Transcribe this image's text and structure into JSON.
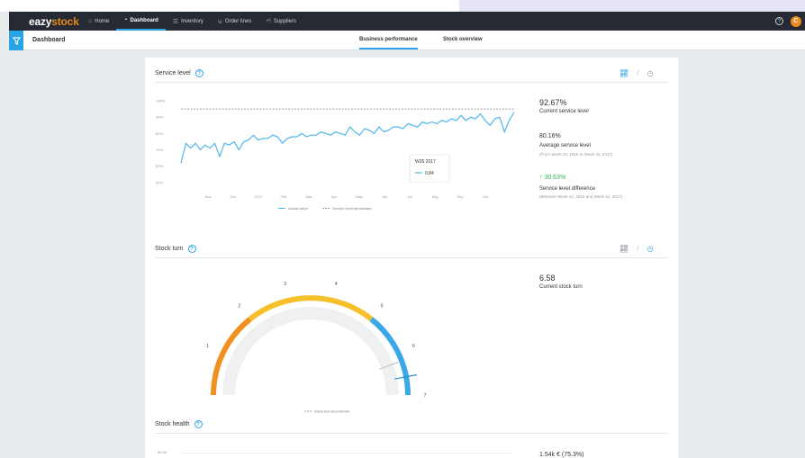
{
  "app": {
    "logo_prefix": "eazy",
    "logo_suffix": "stock",
    "help_glyph": "?",
    "avatar_initial": "C",
    "nav": [
      {
        "label": "Home",
        "icon": "home-icon",
        "glyph": "⌂",
        "active": false
      },
      {
        "label": "Dashboard",
        "icon": "dashboard-icon",
        "glyph": "◔",
        "active": true
      },
      {
        "label": "Inventory",
        "icon": "inventory-icon",
        "glyph": "☰",
        "active": false
      },
      {
        "label": "Order lines",
        "icon": "cart-icon",
        "glyph": "⊍",
        "active": false
      },
      {
        "label": "Suppliers",
        "icon": "suppliers-icon",
        "glyph": "⩤",
        "active": false
      }
    ]
  },
  "subheader": {
    "title": "Dashboard",
    "tabs": [
      {
        "label": "Business performance",
        "active": true
      },
      {
        "label": "Stock overview",
        "active": false
      }
    ]
  },
  "service_level": {
    "title": "Service level",
    "current_value": "92.67%",
    "current_label": "Current service level",
    "average_value": "80.16%",
    "average_label": "Average service level",
    "average_range": "(From Week 42, 2016 to Week 42, 2017)",
    "difference_value": "30.63%",
    "difference_label": "Service level difference",
    "difference_range": "(Between Week 42, 2016 and Week 42, 2017)",
    "tooltip_title": "W26 2017",
    "tooltip_value": "0.84",
    "legend_actual": "Actual value",
    "legend_benchmark": "Service level benchmark"
  },
  "stock_turn": {
    "title": "Stock turn",
    "current_value": "6.58",
    "current_label": "Current stock turn",
    "legend_benchmark": "Stock turn benchmark"
  },
  "stock_health": {
    "title": "Stock health",
    "first_value": "1.54k € (75.3%)",
    "first_tick": "$2.5k"
  },
  "colors": {
    "accent": "#2aa3e5",
    "gauge_orange": "#f0901e",
    "gauge_yellow": "#f7c02a",
    "gauge_blue": "#3aa7e8",
    "positive": "#2db35d"
  },
  "chart_data": [
    {
      "type": "line",
      "title": "Service level",
      "x": [
        "Nov",
        "Dec",
        "2017",
        "Feb",
        "Mar",
        "Apr",
        "May",
        "Jun",
        "Jul",
        "Aug",
        "Sep",
        "Oct"
      ],
      "y_ticks": [
        "100%",
        "90%",
        "80%",
        "70%",
        "60%",
        "50%"
      ],
      "ylim": [
        0.45,
        1.0
      ],
      "series": [
        {
          "name": "Actual value",
          "values": [
            0.62,
            0.74,
            0.71,
            0.74,
            0.7,
            0.73,
            0.71,
            0.74,
            0.66,
            0.74,
            0.73,
            0.75,
            0.7,
            0.75,
            0.76,
            0.79,
            0.76,
            0.77,
            0.77,
            0.79,
            0.78,
            0.74,
            0.77,
            0.78,
            0.78,
            0.8,
            0.78,
            0.79,
            0.79,
            0.81,
            0.8,
            0.79,
            0.81,
            0.8,
            0.79,
            0.84,
            0.81,
            0.79,
            0.83,
            0.82,
            0.8,
            0.84,
            0.81,
            0.82,
            0.84,
            0.84,
            0.83,
            0.86,
            0.85,
            0.84,
            0.87,
            0.86,
            0.87,
            0.86,
            0.88,
            0.87,
            0.89,
            0.88,
            0.91,
            0.88,
            0.9,
            0.89,
            0.92,
            0.88,
            0.85,
            0.89,
            0.9,
            0.81,
            0.88,
            0.93
          ]
        },
        {
          "name": "Service level benchmark",
          "values": [
            0.95,
            0.95
          ]
        }
      ],
      "grid": false,
      "legend": "bottom-center"
    },
    {
      "type": "gauge",
      "title": "Stock turn",
      "min": 0,
      "max": 7,
      "ticks": [
        0,
        1,
        2,
        3,
        4,
        5,
        6,
        7
      ],
      "value": 6.58,
      "benchmark": 6.2,
      "bands": [
        {
          "from": 0,
          "to": 2,
          "color": "#f0901e"
        },
        {
          "from": 2,
          "to": 5,
          "color": "#f7c02a"
        },
        {
          "from": 5,
          "to": 7,
          "color": "#3aa7e8"
        }
      ],
      "legend": "bottom-center"
    }
  ]
}
